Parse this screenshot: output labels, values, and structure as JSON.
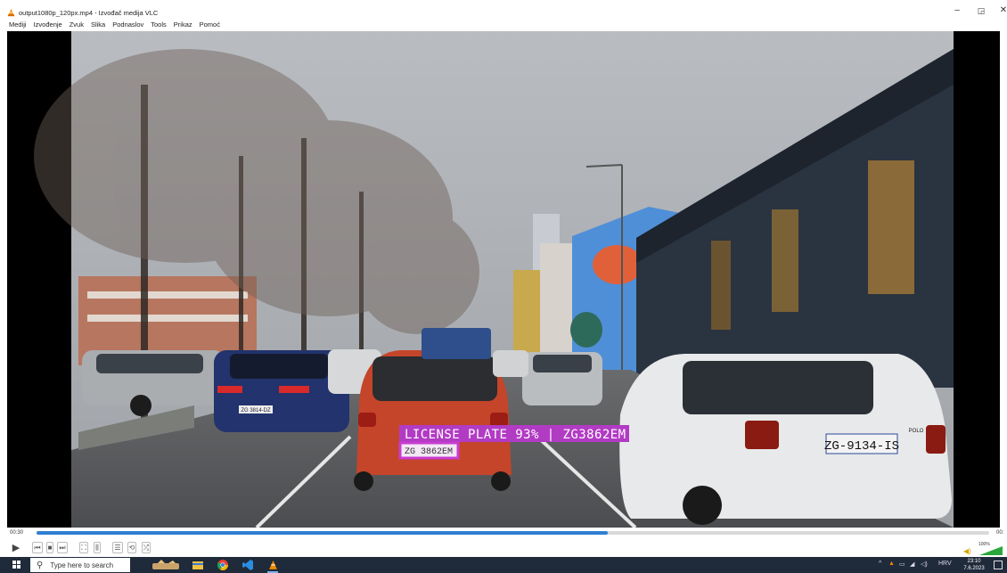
{
  "window": {
    "title": "output1080p_120px.mp4 - Izvođač medija VLC",
    "minimize_label": "–",
    "maximize_label": "◲",
    "close_label": "✕"
  },
  "menu": [
    "Mediji",
    "Izvođenje",
    "Zvuk",
    "Slika",
    "Podnaslov",
    "Tools",
    "Prikaz",
    "Pomoć"
  ],
  "video": {
    "detection_label": "LICENSE PLATE 93% | ZG3862EM",
    "plate_center": "ZG 3862EM",
    "plate_left": "ZG 3814-DZ",
    "plate_right": "ZG-9134-IS",
    "car_badge": "POLO",
    "accent_color": "#c83cd2"
  },
  "player": {
    "elapsed": "00:30",
    "total": "00:",
    "progress": 0.6,
    "volume": "100%"
  },
  "controls": {
    "play_icon": "▶",
    "prev_icon": "⏮",
    "stop_icon": "■",
    "next_icon": "⏭",
    "fullscreen_icon": "⛶",
    "extended_icon": "⫼",
    "playlist_icon": "☰",
    "loop_icon": "⟲",
    "shuffle_icon": "⤮"
  },
  "taskbar": {
    "search_placeholder": "Type here to search",
    "language": "HRV",
    "time": "23:10",
    "date": "7.6.2023"
  }
}
